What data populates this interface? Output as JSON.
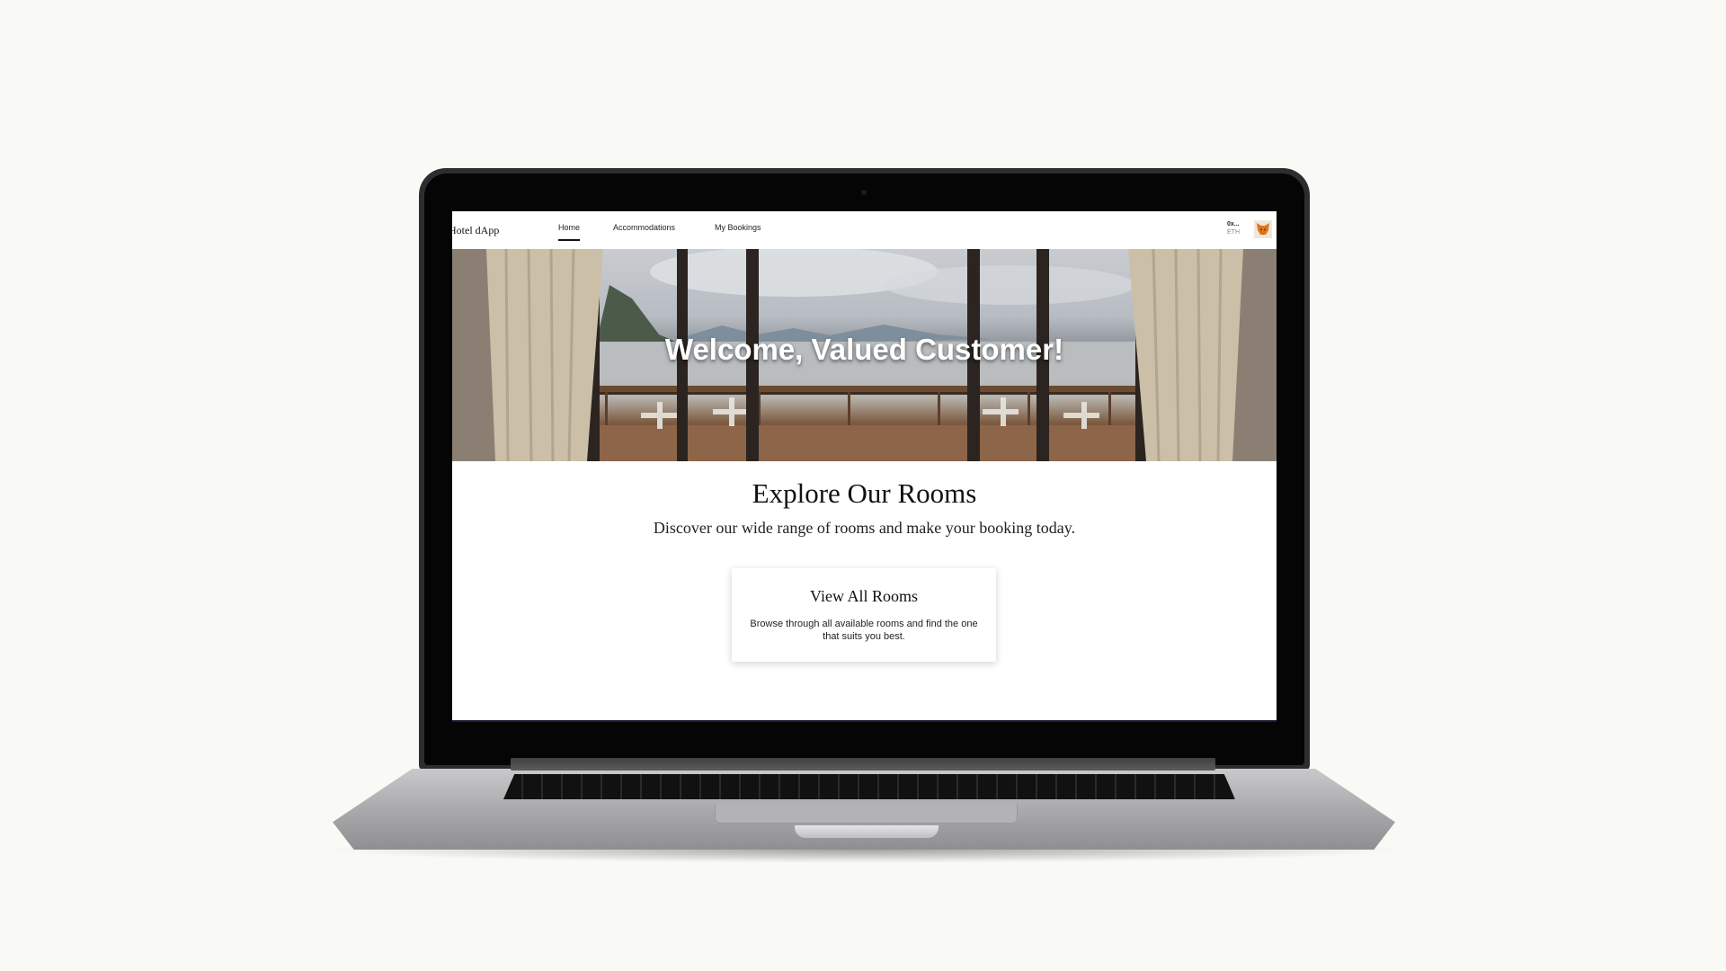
{
  "navbar": {
    "brand": "Hotel dApp",
    "items": [
      {
        "label": "Home",
        "active": true
      },
      {
        "label": "Accommodations",
        "active": false
      },
      {
        "label": "My Bookings",
        "active": false
      }
    ],
    "wallet": {
      "address": "0x...",
      "currency": "ETH",
      "icon": "metamask-fox-icon"
    }
  },
  "hero": {
    "title": "Welcome, Valued Customer!"
  },
  "explore": {
    "title": "Explore Our Rooms",
    "subtitle": "Discover our wide range of rooms and make your booking today."
  },
  "card": {
    "title": "View All Rooms",
    "description": "Browse through all available rooms and find the one that suits you best."
  },
  "colors": {
    "footer_bar": "#1d1a3a",
    "text": "#111111",
    "background": "#f9f9f5"
  }
}
